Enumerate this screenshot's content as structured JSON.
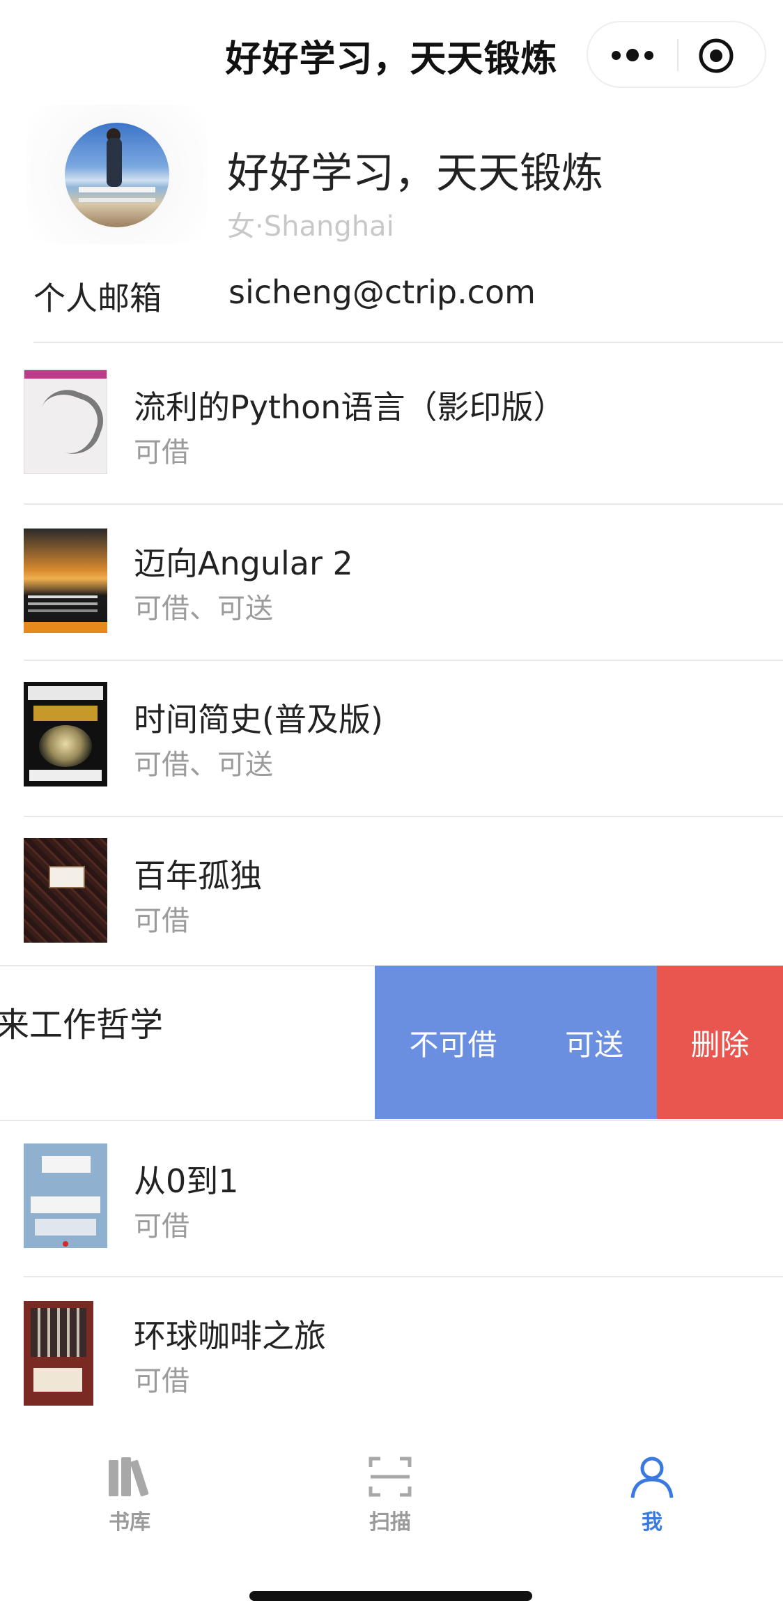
{
  "navbar": {
    "title": "好好学习，天天锻炼",
    "more_icon": "more-dots-icon",
    "close_icon": "target-close-icon"
  },
  "profile": {
    "name": "好好学习，天天锻炼",
    "subtitle": "女·Shanghai",
    "email_label": "个人邮箱",
    "email": "sicheng@ctrip.com"
  },
  "books": [
    {
      "title": "流利的Python语言（影印版）",
      "status": "可借"
    },
    {
      "title": "迈向Angular 2",
      "status": "可借、可送"
    },
    {
      "title": "时间简史(普及版)",
      "status": "可借、可送"
    },
    {
      "title": "百年孤独",
      "status": "可借"
    },
    {
      "title": "从0到1",
      "status": "可借"
    },
    {
      "title": "环球咖啡之旅",
      "status": "可借"
    }
  ],
  "swiped_row": {
    "title_fragment": "来工作哲学",
    "actions": {
      "not_borrowable": "不可借",
      "giveable": "可送",
      "delete": "删除"
    },
    "colors": {
      "primary_action": "#6b8fe0",
      "delete_action": "#e9564f"
    }
  },
  "tabbar": {
    "tabs": [
      {
        "label": "书库",
        "icon": "books-icon",
        "active": false
      },
      {
        "label": "扫描",
        "icon": "scan-icon",
        "active": false
      },
      {
        "label": "我",
        "icon": "user-icon",
        "active": true
      }
    ],
    "active_color": "#3a7ae0",
    "inactive_color": "#9a9a9a"
  }
}
